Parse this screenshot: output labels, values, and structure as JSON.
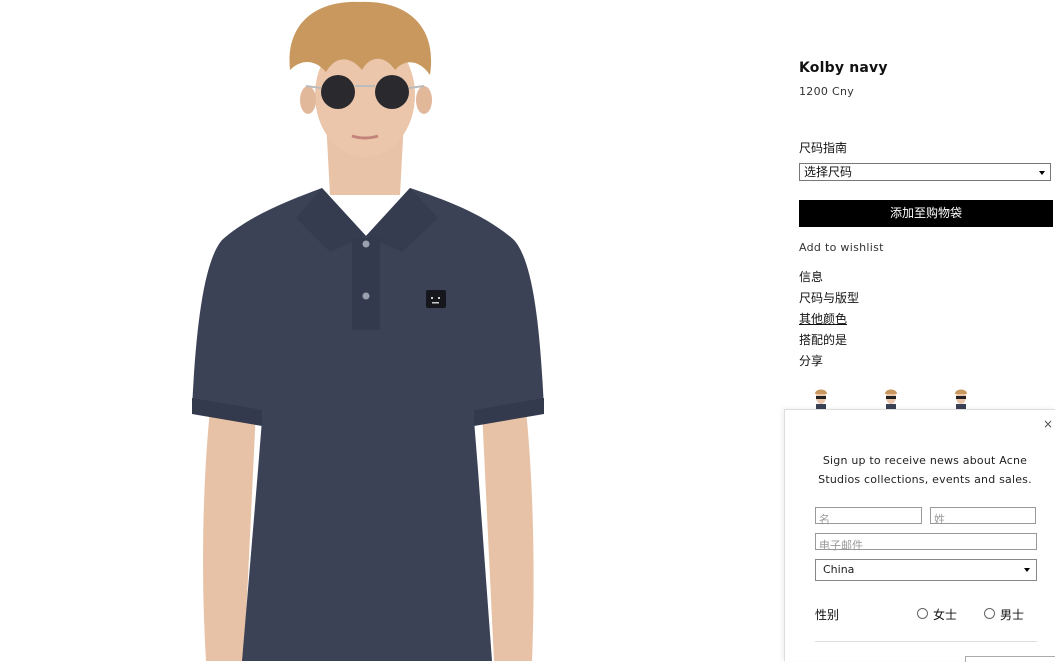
{
  "product": {
    "name": "Kolby navy",
    "price": "1200 Cny",
    "image_alt": "Model wearing navy polo shirt"
  },
  "size": {
    "guide_label": "尺码指南",
    "select_value": "选择尺码"
  },
  "actions": {
    "add_to_bag": "添加至购物袋",
    "wishlist": "Add to wishlist"
  },
  "details_links": [
    "信息",
    "尺码与版型",
    "其他颜色",
    "搭配的是",
    "分享"
  ],
  "colors": {
    "accent": "#000000",
    "shirt": "#3b4256"
  },
  "newsletter": {
    "close": "×",
    "text": "Sign up to receive news about Acne Studios collections, events and sales.",
    "first_name_placeholder": "名",
    "last_name_placeholder": "姓",
    "email_placeholder": "电子邮件",
    "country_value": "China",
    "gender_label": "性别",
    "gender_options": [
      "女士",
      "男士"
    ]
  }
}
